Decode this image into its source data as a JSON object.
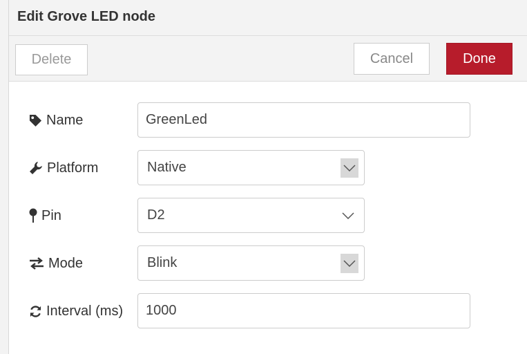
{
  "dialog": {
    "title": "Edit Grove LED node"
  },
  "toolbar": {
    "delete_label": "Delete",
    "cancel_label": "Cancel",
    "done_label": "Done"
  },
  "form": {
    "name": {
      "label": "Name",
      "icon": "tag-icon",
      "value": "GreenLed"
    },
    "platform": {
      "label": "Platform",
      "icon": "wrench-icon",
      "value": "Native"
    },
    "pin": {
      "label": "Pin",
      "icon": "map-pin-icon",
      "value": "D2"
    },
    "mode": {
      "label": "Mode",
      "icon": "exchange-icon",
      "value": "Blink"
    },
    "interval": {
      "label": "Interval (ms)",
      "icon": "refresh-icon",
      "value": "1000"
    }
  },
  "colors": {
    "done_button": "#b71c2b",
    "header_bg": "#f3f3f3"
  }
}
